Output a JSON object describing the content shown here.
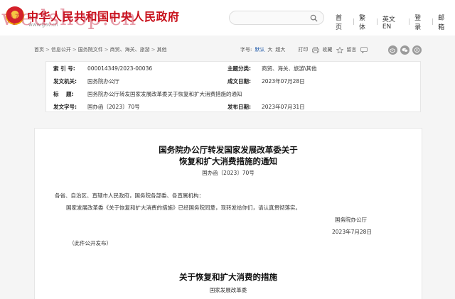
{
  "header": {
    "site_title": "中华人民共和国中央人民政府",
    "site_url": "www.gov.cn",
    "watermark": "wedshop.cn",
    "nav": [
      "首页",
      "繁体",
      "英文EN",
      "登录",
      "邮箱"
    ]
  },
  "breadcrumb": {
    "items": [
      "首页",
      "信息公开",
      "国务院文件",
      "商贸、海关、旅游",
      "其他"
    ],
    "separator": ">"
  },
  "tools": {
    "font_label": "字号:",
    "font_default": "默认",
    "font_large": "大",
    "font_xlarge": "超大",
    "print": "打印",
    "favorite": "收藏",
    "comment": "留言"
  },
  "info": {
    "index_label": "索 引 号:",
    "index_value": "000014349/2023-00036",
    "category_label": "主题分类:",
    "category_value": "商贸、海关、旅游\\其他",
    "issuer_label": "发文机关:",
    "issuer_value": "国务院办公厅",
    "written_label": "成文日期:",
    "written_value": "2023年07月28日",
    "title_label": "标    题:",
    "title_value": "国务院办公厅转发国家发展改革委关于恢复和扩大消费措施的通知",
    "doc_no_label": "发文字号:",
    "doc_no_value": "国办函〔2023〕70号",
    "publish_label": "发布日期:",
    "publish_value": "2023年07月31日"
  },
  "document": {
    "title_line1": "国务院办公厅转发国家发展改革委关于",
    "title_line2": "恢复和扩大消费措施的通知",
    "doc_no": "国办函〔2023〕70号",
    "recipients": "各省、自治区、直辖市人民政府，国务院各部委、各直属机构：",
    "body": "国家发展改革委《关于恢复和扩大消费的措施》已经国务院同意，现转发给你们，请认真贯彻落实。",
    "signatory": "国务院办公厅",
    "date": "2023年7月28日",
    "note": "（此件公开发布）",
    "section_title": "关于恢复和扩大消费的措施",
    "section_author": "国家发展改革委"
  }
}
